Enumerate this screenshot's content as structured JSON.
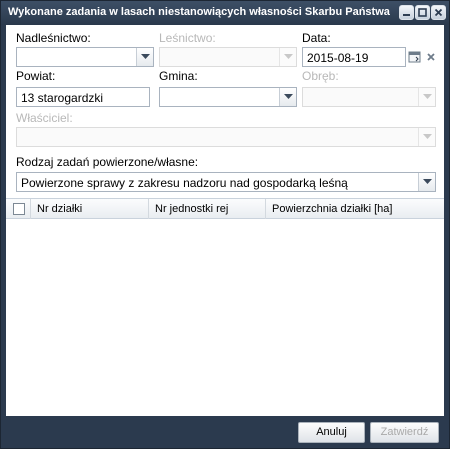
{
  "window": {
    "title": "Wykonane zadania w lasach niestanowiących własności Skarbu Państwa"
  },
  "form": {
    "nadlesnictwo": {
      "label": "Nadleśnictwo:",
      "value": ""
    },
    "lesnictwo": {
      "label": "Leśnictwo:",
      "value": ""
    },
    "data": {
      "label": "Data:",
      "value": "2015-08-19"
    },
    "powiat": {
      "label": "Powiat:",
      "value": "13 starogardzki"
    },
    "gmina": {
      "label": "Gmina:",
      "value": ""
    },
    "obreb": {
      "label": "Obręb:",
      "value": ""
    },
    "wlasciciel": {
      "label": "Właściciel:",
      "value": ""
    },
    "rodzaj": {
      "label": "Rodzaj zadań powierzone/własne:",
      "value": "Powierzone sprawy z zakresu nadzoru nad gospodarką leśną"
    }
  },
  "grid": {
    "columns": [
      "Nr działki",
      "Nr jednostki rej",
      "Powierzchnia działki [ha]"
    ],
    "rows": []
  },
  "footer": {
    "cancel_label": "Anuluj",
    "confirm_label": "Zatwierdź"
  },
  "colors": {
    "frame": "#2b3a4e",
    "field_border": "#a9b3bf",
    "disabled_text": "#b8b8b8"
  }
}
